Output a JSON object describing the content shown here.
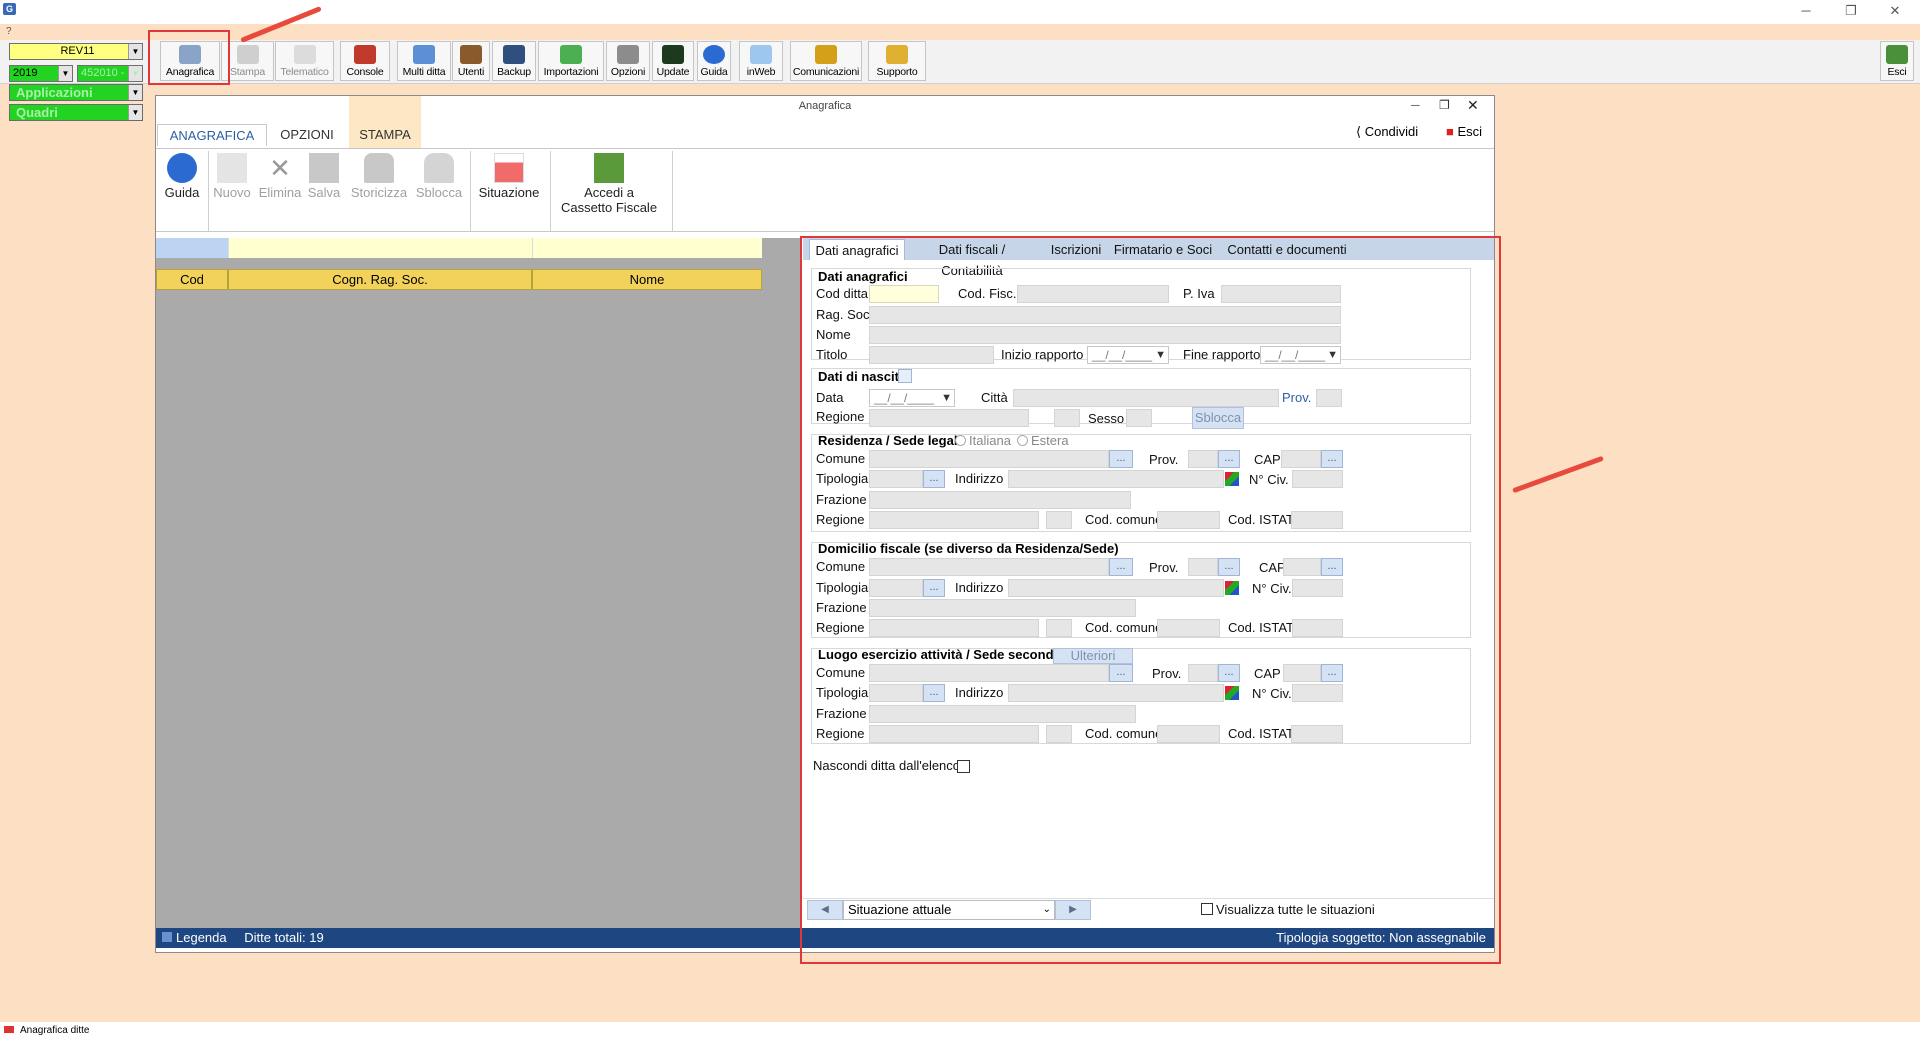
{
  "window": {
    "minimize": "─",
    "maximize": "❐",
    "close": "✕",
    "help": "?"
  },
  "left_combos": {
    "rev": "REV11",
    "year": "2019",
    "code": "452010 -",
    "applicazioni": "Applicazioni",
    "quadri": "Quadri"
  },
  "toolbar": {
    "buttons": [
      {
        "label": "Anagrafica",
        "icon": "car-icon"
      },
      {
        "label": "Stampa",
        "icon": "printer-icon"
      },
      {
        "label": "Telematico",
        "icon": "telematico-icon"
      },
      {
        "label": "Console",
        "icon": "console-icon"
      },
      {
        "label": "Multi ditta",
        "icon": "network-icon"
      },
      {
        "label": "Utenti",
        "icon": "users-icon"
      },
      {
        "label": "Backup",
        "icon": "backup-icon"
      },
      {
        "label": "Importazioni",
        "icon": "download-icon"
      },
      {
        "label": "Opzioni",
        "icon": "wrench-icon"
      },
      {
        "label": "Update",
        "icon": "monitor-icon"
      },
      {
        "label": "Guida",
        "icon": "help-icon"
      },
      {
        "label": "inWeb",
        "icon": "cloud-icon"
      },
      {
        "label": "Comunicazioni",
        "icon": "mail-icon"
      },
      {
        "label": "Supporto",
        "icon": "support-icon"
      },
      {
        "label": "Esci",
        "icon": "exit-icon"
      }
    ]
  },
  "anagrafica": {
    "title": "Anagrafica",
    "condividi": "Condividi",
    "esci": "Esci",
    "tabs": [
      "ANAGRAFICA",
      "OPZIONI",
      "STAMPA"
    ],
    "ribbon": [
      {
        "label": "Guida"
      },
      {
        "label": "Nuovo"
      },
      {
        "label": "Elimina"
      },
      {
        "label": "Salva"
      },
      {
        "label": "Storicizza"
      },
      {
        "label": "Sblocca"
      },
      {
        "label": "Situazione"
      },
      {
        "label": "Accedi a"
      },
      {
        "label": "Cassetto Fiscale"
      }
    ],
    "grid": {
      "headers": [
        "Cod",
        "Cogn. Rag. Soc.",
        "Nome"
      ]
    },
    "status": {
      "legenda": "Legenda",
      "totali": "Ditte totali: 19",
      "tipologia": "Tipologia soggetto: Non assegnabile"
    }
  },
  "form": {
    "tabs": [
      "Dati anagrafici",
      "Dati fiscali / Contabilità",
      "Iscrizioni",
      "Firmatario e Soci",
      "Contatti e documenti"
    ],
    "dati_anagrafici": {
      "title": "Dati anagrafici",
      "cod_ditta": "Cod ditta",
      "cod_fisc": "Cod. Fisc.",
      "p_iva": "P. Iva",
      "rag_soc": "Rag. Soc.",
      "nome": "Nome",
      "titolo": "Titolo",
      "inizio": "Inizio rapporto",
      "fine": "Fine rapporto",
      "date_ph": "__/__/____"
    },
    "nascita": {
      "title": "Dati di nascita",
      "data": "Data",
      "citta": "Città",
      "prov": "Prov.",
      "regione": "Regione",
      "sesso": "Sesso",
      "sblocca": "Sblocca"
    },
    "residenza": {
      "title": "Residenza / Sede legale",
      "italiana": "Italiana",
      "estera": "Estera"
    },
    "domicilio": {
      "title": "Domicilio fiscale (se diverso da Residenza/Sede)"
    },
    "luogo": {
      "title": "Luogo esercizio attività / Sede secondaria",
      "ulteriori": "Ulteriori"
    },
    "addr": {
      "comune": "Comune",
      "prov": "Prov.",
      "cap": "CAP",
      "tipologia": "Tipologia",
      "indirizzo": "Indirizzo",
      "civ": "N° Civ.",
      "frazione": "Frazione",
      "regione": "Regione",
      "cod_comune": "Cod. comune",
      "istat": "Cod. ISTAT",
      "dots": "..."
    },
    "nascondi": "Nascondi ditta dall'elenco",
    "situazione": "Situazione attuale",
    "visualizza": "Visualizza tutte le situazioni",
    "nav_prev": "◀",
    "nav_next": "▶"
  },
  "app_status": "Anagrafica ditte"
}
